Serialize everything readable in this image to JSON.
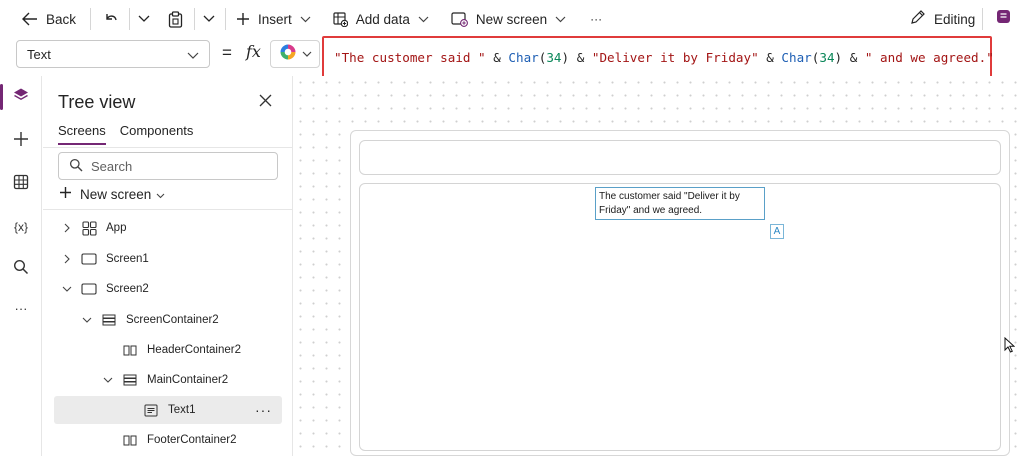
{
  "toolbar": {
    "back_label": "Back",
    "insert_label": "Insert",
    "add_data_label": "Add data",
    "new_screen_label": "New screen",
    "more_label": "···",
    "editing_label": "Editing"
  },
  "formula_bar": {
    "property": "Text",
    "equals": "=",
    "fx": "fx",
    "tokens": {
      "s1": "\"The customer said \"",
      "amp1": " & ",
      "fn1": "Char",
      "p1o": "(",
      "n1": "34",
      "p1c": ")",
      "amp2": " & ",
      "s2": "\"Deliver it by Friday\"",
      "amp3": " & ",
      "fn2": "Char",
      "p2o": "(",
      "n2": "34",
      "p2c": ")",
      "amp4": " & ",
      "s3": "\" and we agreed.\""
    },
    "highlight_color": "#e03b3b"
  },
  "rail": {
    "icons": [
      "layers-icon",
      "plus-icon",
      "data-grid-icon",
      "variables-icon",
      "search-icon",
      "more-icon"
    ],
    "variables_label": "{x}",
    "more_label": "···"
  },
  "tree_view": {
    "title": "Tree view",
    "tabs": [
      "Screens",
      "Components"
    ],
    "search_placeholder": "Search",
    "new_screen_label": "New screen",
    "nodes": [
      {
        "label": "App"
      },
      {
        "label": "Screen1"
      },
      {
        "label": "Screen2"
      },
      {
        "label": "ScreenContainer2"
      },
      {
        "label": "HeaderContainer2"
      },
      {
        "label": "MainContainer2"
      },
      {
        "label": "Text1"
      },
      {
        "label": "FooterContainer2"
      }
    ],
    "node_more": "···"
  },
  "canvas": {
    "text_control_value": "The customer said \"Deliver it by Friday\" and we agreed.",
    "badge_label": "A"
  },
  "colors": {
    "accent": "#742774",
    "selection_border": "#5aa0c8",
    "string_token": "#a31515",
    "function_token": "#1e5fb4",
    "number_token": "#098658"
  }
}
